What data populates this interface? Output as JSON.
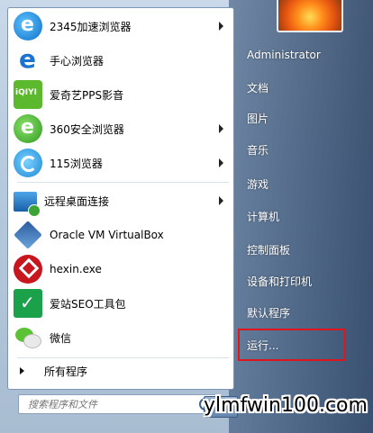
{
  "left_menu": {
    "items": [
      {
        "label": "2345加速浏览器",
        "icon": "2345-browser-icon",
        "has_submenu": true
      },
      {
        "label": "手心浏览器",
        "icon": "shouxin-browser-icon",
        "has_submenu": false
      },
      {
        "label": "爱奇艺PPS影音",
        "icon": "iqiyi-pps-icon",
        "has_submenu": false
      },
      {
        "label": "360安全浏览器",
        "icon": "360-browser-icon",
        "has_submenu": true
      },
      {
        "label": "115浏览器",
        "icon": "115-browser-icon",
        "has_submenu": true
      },
      {
        "label": "远程桌面连接",
        "icon": "remote-desktop-icon",
        "has_submenu": true
      },
      {
        "label": "Oracle VM VirtualBox",
        "icon": "virtualbox-icon",
        "has_submenu": false
      },
      {
        "label": "hexin.exe",
        "icon": "hexin-icon",
        "has_submenu": false
      },
      {
        "label": "爱站SEO工具包",
        "icon": "aizhan-seo-icon",
        "has_submenu": false
      },
      {
        "label": "微信",
        "icon": "wechat-icon",
        "has_submenu": false
      }
    ],
    "all_programs": "所有程序"
  },
  "search": {
    "placeholder": "搜索程序和文件"
  },
  "right_menu": {
    "user": "Administrator",
    "items": [
      "文档",
      "图片",
      "音乐",
      "游戏",
      "计算机",
      "控制面板",
      "设备和打印机",
      "默认程序",
      "运行..."
    ]
  },
  "watermark": "ylmfwin100.com",
  "colors": {
    "highlight_box": "#e0141b"
  }
}
